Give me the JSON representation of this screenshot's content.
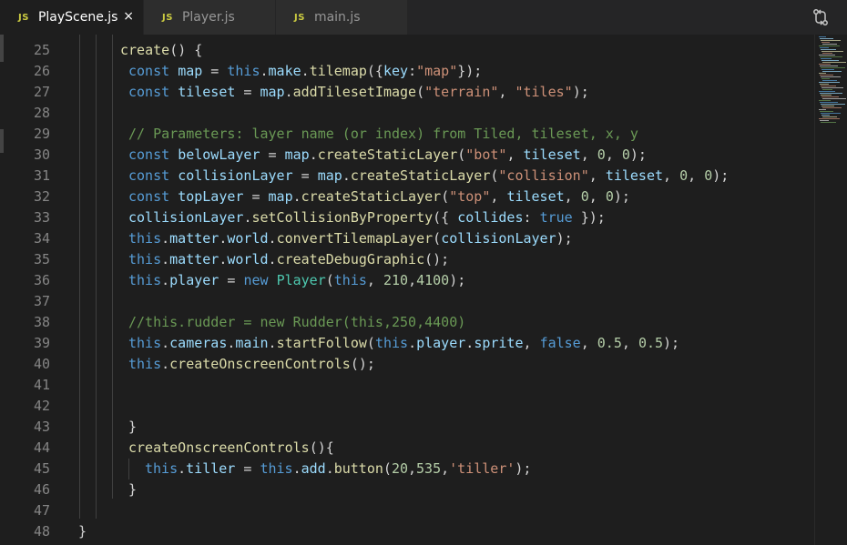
{
  "tabs": [
    {
      "icon": "JS",
      "label": "PlayScene.js",
      "active": true,
      "close": "×"
    },
    {
      "icon": "JS",
      "label": "Player.js",
      "active": false
    },
    {
      "icon": "JS",
      "label": "main.js",
      "active": false
    }
  ],
  "colors": {
    "keyword": "#569cd6",
    "variable": "#9cdcfe",
    "function": "#dcdcaa",
    "string": "#ce9178",
    "number": "#b5cea8",
    "comment": "#6a9955",
    "class": "#4ec9b0",
    "text": "#d4d4d4",
    "background": "#1e1e1e"
  },
  "lines": [
    {
      "n": "25",
      "indent": 0,
      "tokens": [
        [
          "fn",
          "create"
        ],
        [
          "pun",
          "() {"
        ]
      ]
    },
    {
      "n": "26",
      "indent": 1,
      "tokens": [
        [
          "kw",
          "const"
        ],
        [
          "pun",
          " "
        ],
        [
          "var",
          "map"
        ],
        [
          "pun",
          " = "
        ],
        [
          "kw",
          "this"
        ],
        [
          "pun",
          "."
        ],
        [
          "var",
          "make"
        ],
        [
          "pun",
          "."
        ],
        [
          "fn",
          "tilemap"
        ],
        [
          "pun",
          "({"
        ],
        [
          "var",
          "key"
        ],
        [
          "pun",
          ":"
        ],
        [
          "str",
          "\"map\""
        ],
        [
          "pun",
          "});"
        ]
      ]
    },
    {
      "n": "27",
      "indent": 1,
      "tokens": [
        [
          "kw",
          "const"
        ],
        [
          "pun",
          " "
        ],
        [
          "var",
          "tileset"
        ],
        [
          "pun",
          " = "
        ],
        [
          "var",
          "map"
        ],
        [
          "pun",
          "."
        ],
        [
          "fn",
          "addTilesetImage"
        ],
        [
          "pun",
          "("
        ],
        [
          "str",
          "\"terrain\""
        ],
        [
          "pun",
          ", "
        ],
        [
          "str",
          "\"tiles\""
        ],
        [
          "pun",
          ");"
        ]
      ]
    },
    {
      "n": "28",
      "indent": 1,
      "tokens": []
    },
    {
      "n": "29",
      "indent": 1,
      "tokens": [
        [
          "cm",
          "// Parameters: layer name (or index) from Tiled, tileset, x, y"
        ]
      ]
    },
    {
      "n": "30",
      "indent": 1,
      "tokens": [
        [
          "kw",
          "const"
        ],
        [
          "pun",
          " "
        ],
        [
          "var",
          "belowLayer"
        ],
        [
          "pun",
          " = "
        ],
        [
          "var",
          "map"
        ],
        [
          "pun",
          "."
        ],
        [
          "fn",
          "createStaticLayer"
        ],
        [
          "pun",
          "("
        ],
        [
          "str",
          "\"bot\""
        ],
        [
          "pun",
          ", "
        ],
        [
          "var",
          "tileset"
        ],
        [
          "pun",
          ", "
        ],
        [
          "num",
          "0"
        ],
        [
          "pun",
          ", "
        ],
        [
          "num",
          "0"
        ],
        [
          "pun",
          ");"
        ]
      ]
    },
    {
      "n": "31",
      "indent": 1,
      "tokens": [
        [
          "kw",
          "const"
        ],
        [
          "pun",
          " "
        ],
        [
          "var",
          "collisionLayer"
        ],
        [
          "pun",
          " = "
        ],
        [
          "var",
          "map"
        ],
        [
          "pun",
          "."
        ],
        [
          "fn",
          "createStaticLayer"
        ],
        [
          "pun",
          "("
        ],
        [
          "str",
          "\"collision\""
        ],
        [
          "pun",
          ", "
        ],
        [
          "var",
          "tileset"
        ],
        [
          "pun",
          ", "
        ],
        [
          "num",
          "0"
        ],
        [
          "pun",
          ", "
        ],
        [
          "num",
          "0"
        ],
        [
          "pun",
          ");"
        ]
      ]
    },
    {
      "n": "32",
      "indent": 1,
      "tokens": [
        [
          "kw",
          "const"
        ],
        [
          "pun",
          " "
        ],
        [
          "var",
          "topLayer"
        ],
        [
          "pun",
          " = "
        ],
        [
          "var",
          "map"
        ],
        [
          "pun",
          "."
        ],
        [
          "fn",
          "createStaticLayer"
        ],
        [
          "pun",
          "("
        ],
        [
          "str",
          "\"top\""
        ],
        [
          "pun",
          ", "
        ],
        [
          "var",
          "tileset"
        ],
        [
          "pun",
          ", "
        ],
        [
          "num",
          "0"
        ],
        [
          "pun",
          ", "
        ],
        [
          "num",
          "0"
        ],
        [
          "pun",
          ");"
        ]
      ]
    },
    {
      "n": "33",
      "indent": 1,
      "tokens": [
        [
          "var",
          "collisionLayer"
        ],
        [
          "pun",
          "."
        ],
        [
          "fn",
          "setCollisionByProperty"
        ],
        [
          "pun",
          "({ "
        ],
        [
          "var",
          "collides"
        ],
        [
          "pun",
          ": "
        ],
        [
          "kw",
          "true"
        ],
        [
          "pun",
          " });"
        ]
      ]
    },
    {
      "n": "34",
      "indent": 1,
      "tokens": [
        [
          "kw",
          "this"
        ],
        [
          "pun",
          "."
        ],
        [
          "var",
          "matter"
        ],
        [
          "pun",
          "."
        ],
        [
          "var",
          "world"
        ],
        [
          "pun",
          "."
        ],
        [
          "fn",
          "convertTilemapLayer"
        ],
        [
          "pun",
          "("
        ],
        [
          "var",
          "collisionLayer"
        ],
        [
          "pun",
          ");"
        ]
      ]
    },
    {
      "n": "35",
      "indent": 1,
      "tokens": [
        [
          "kw",
          "this"
        ],
        [
          "pun",
          "."
        ],
        [
          "var",
          "matter"
        ],
        [
          "pun",
          "."
        ],
        [
          "var",
          "world"
        ],
        [
          "pun",
          "."
        ],
        [
          "fn",
          "createDebugGraphic"
        ],
        [
          "pun",
          "();"
        ]
      ]
    },
    {
      "n": "36",
      "indent": 1,
      "tokens": [
        [
          "kw",
          "this"
        ],
        [
          "pun",
          "."
        ],
        [
          "var",
          "player"
        ],
        [
          "pun",
          " = "
        ],
        [
          "kw",
          "new"
        ],
        [
          "pun",
          " "
        ],
        [
          "cls",
          "Player"
        ],
        [
          "pun",
          "("
        ],
        [
          "kw",
          "this"
        ],
        [
          "pun",
          ", "
        ],
        [
          "num",
          "210"
        ],
        [
          "pun",
          ","
        ],
        [
          "num",
          "4100"
        ],
        [
          "pun",
          ");"
        ]
      ]
    },
    {
      "n": "37",
      "indent": 1,
      "tokens": []
    },
    {
      "n": "38",
      "indent": 1,
      "tokens": [
        [
          "cm",
          "//this.rudder = new Rudder(this,250,4400)"
        ]
      ]
    },
    {
      "n": "39",
      "indent": 1,
      "tokens": [
        [
          "kw",
          "this"
        ],
        [
          "pun",
          "."
        ],
        [
          "var",
          "cameras"
        ],
        [
          "pun",
          "."
        ],
        [
          "var",
          "main"
        ],
        [
          "pun",
          "."
        ],
        [
          "fn",
          "startFollow"
        ],
        [
          "pun",
          "("
        ],
        [
          "kw",
          "this"
        ],
        [
          "pun",
          "."
        ],
        [
          "var",
          "player"
        ],
        [
          "pun",
          "."
        ],
        [
          "var",
          "sprite"
        ],
        [
          "pun",
          ", "
        ],
        [
          "kw",
          "false"
        ],
        [
          "pun",
          ", "
        ],
        [
          "num",
          "0.5"
        ],
        [
          "pun",
          ", "
        ],
        [
          "num",
          "0.5"
        ],
        [
          "pun",
          ");"
        ]
      ]
    },
    {
      "n": "40",
      "indent": 1,
      "tokens": [
        [
          "kw",
          "this"
        ],
        [
          "pun",
          "."
        ],
        [
          "fn",
          "createOnscreenControls"
        ],
        [
          "pun",
          "();"
        ]
      ]
    },
    {
      "n": "41",
      "indent": 1,
      "tokens": []
    },
    {
      "n": "42",
      "indent": 1,
      "tokens": []
    },
    {
      "n": "43",
      "indent": 1,
      "tokens": [
        [
          "pun",
          "}"
        ]
      ]
    },
    {
      "n": "44",
      "indent": 1,
      "tokens": [
        [
          "fn",
          "createOnscreenControls"
        ],
        [
          "pun",
          "(){"
        ]
      ]
    },
    {
      "n": "45",
      "indent": 2,
      "tokens": [
        [
          "kw",
          "this"
        ],
        [
          "pun",
          "."
        ],
        [
          "var",
          "tiller"
        ],
        [
          "pun",
          " = "
        ],
        [
          "kw",
          "this"
        ],
        [
          "pun",
          "."
        ],
        [
          "var",
          "add"
        ],
        [
          "pun",
          "."
        ],
        [
          "fn",
          "button"
        ],
        [
          "pun",
          "("
        ],
        [
          "num",
          "20"
        ],
        [
          "pun",
          ","
        ],
        [
          "num",
          "535"
        ],
        [
          "pun",
          ","
        ],
        [
          "str",
          "'tiller'"
        ],
        [
          "pun",
          ");"
        ]
      ]
    },
    {
      "n": "46",
      "indent": 1,
      "tokens": [
        [
          "pun",
          "}"
        ]
      ]
    },
    {
      "n": "47",
      "indent": 0,
      "tokens": []
    },
    {
      "n": "48",
      "indent": -1,
      "tokens": [
        [
          "pun",
          "}"
        ]
      ]
    }
  ],
  "icons": {
    "compare": "git-compare-icon"
  }
}
